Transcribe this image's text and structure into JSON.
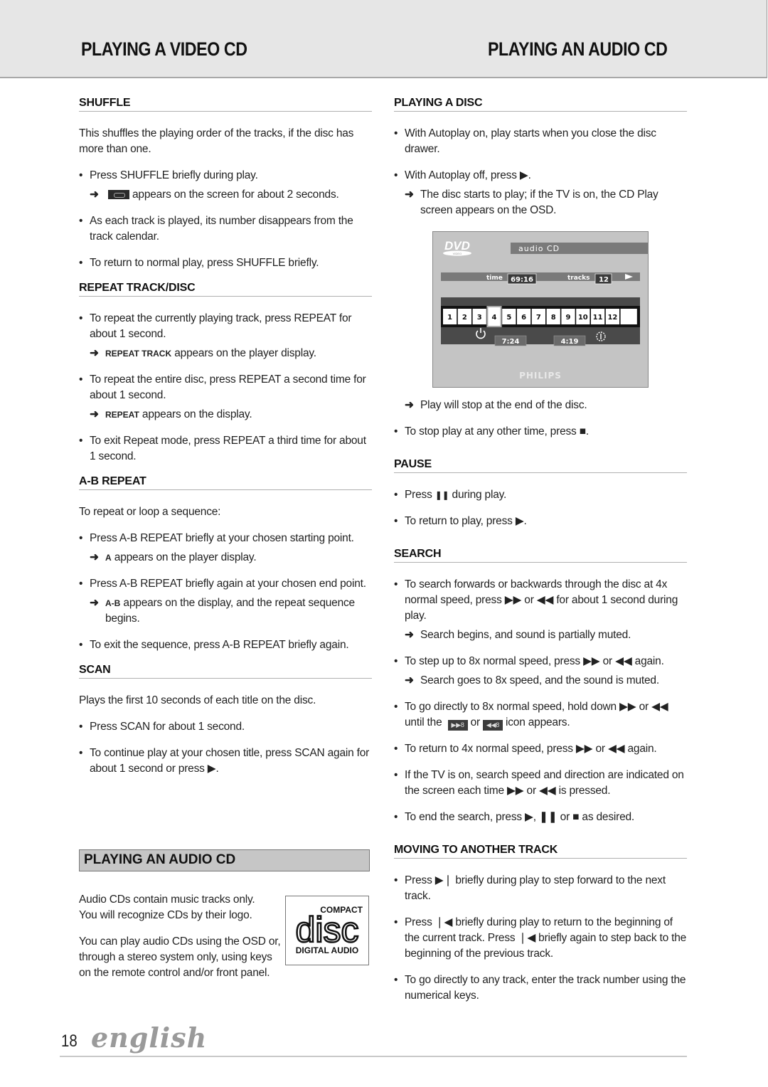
{
  "header": {
    "left_title": "PLAYING A VIDEO CD",
    "right_title": "PLAYING AN AUDIO CD"
  },
  "left": {
    "shuffle": {
      "heading": "SHUFFLE",
      "intro": "This shuffles the playing order of the tracks, if the disc has more  than one.",
      "b1": "Press SHUFFLE briefly during play.",
      "r1": "appears on the screen for about 2 seconds.",
      "b2": "As each track is played, its number disappears from the track calendar.",
      "b3": "To return to normal play, press SHUFFLE briefly."
    },
    "repeat": {
      "heading": "REPEAT TRACK/DISC",
      "b1": "To repeat the currently playing track, press REPEAT for about 1 second.",
      "r1_code": "REPEAT TRACK",
      "r1": " appears on the player display.",
      "b2": "To repeat the entire disc, press REPEAT a second time for about 1 second.",
      "r2_code": "REPEAT",
      "r2": " appears on the display.",
      "b3": "To exit Repeat mode, press REPEAT a third time for about 1 second."
    },
    "ab": {
      "heading": "A-B REPEAT",
      "intro": "To repeat or loop a sequence:",
      "b1": "Press A-B REPEAT briefly at your chosen starting point.",
      "r1_code": "A",
      "r1": " appears on the player display.",
      "b2": "Press A-B REPEAT briefly again at your chosen end point.",
      "r2_code": "A-B",
      "r2": " appears on the display, and the repeat sequence begins.",
      "b3": "To exit the sequence, press A-B REPEAT briefly again."
    },
    "scan": {
      "heading": "SCAN",
      "intro": "Plays the first 10 seconds of each title on the disc.",
      "b1": "Press SCAN for about 1 second.",
      "b2": "To continue play at your chosen title, press SCAN again for about 1 second or press ▶."
    },
    "audio_band": "PLAYING AN AUDIO CD",
    "audio_intro_1": "Audio CDs contain music tracks only. You will recognize CDs by their logo.",
    "audio_intro_2": "You can play audio CDs using the OSD or, through a stereo system only, using keys on the remote control and/or front panel.",
    "cd_logo": {
      "top": "COMPACT",
      "mid": "disc",
      "bottom": "DIGITAL AUDIO"
    }
  },
  "right": {
    "playing": {
      "heading": "PLAYING A DISC",
      "b1": "With Autoplay on, play starts when you close the disc drawer.",
      "b2": "With Autoplay off, press ▶.",
      "r1": "The disc starts to play; if the TV is on, the CD Play screen appears on the OSD.",
      "r2": "Play will stop at the end of the disc.",
      "b3": "To stop play at any other time, press ■."
    },
    "osd": {
      "logo": "DVD",
      "logo_sub": "VIDEO",
      "mode": "audio CD",
      "time_label": "time",
      "time_value": "69:16",
      "tracks_label": "tracks",
      "tracks_value": "12",
      "track_numbers": [
        "1",
        "2",
        "3",
        "4",
        "5",
        "6",
        "7",
        "8",
        "9",
        "10",
        "11",
        "12"
      ],
      "current_track": "4",
      "elapsed": "7:24",
      "remaining": "4:19",
      "brand": "PHILIPS"
    },
    "pause": {
      "heading": "PAUSE",
      "b1_pre": "Press ",
      "b1_post": " during play.",
      "b2": "To return to play, press ▶."
    },
    "search": {
      "heading": "SEARCH",
      "b1": "To search forwards or backwards through the disc at 4x normal speed, press ▶▶  or ◀◀ for about 1 second during play.",
      "r1": "Search begins, and sound is partially muted.",
      "b2": "To step up to 8x normal speed, press ▶▶  or ◀◀ again.",
      "r2": "Search goes to 8x speed, and the sound is muted.",
      "b3_pre": "To go directly to 8x normal speed, hold down ▶▶  or ◀◀ until the",
      "b3_or": "or",
      "b3_post": "icon appears.",
      "fwd_icon": "▶▶8",
      "rev_icon": "◀◀8",
      "b4": "To return to 4x normal speed, press ▶▶  or ◀◀ again.",
      "b5": "If the TV is on, search speed and direction are indicated on the screen each time ▶▶  or ◀◀ is pressed.",
      "b6": "To end the search, press ▶, ❚❚ or ■ as desired."
    },
    "moving": {
      "heading": "MOVING TO ANOTHER TRACK",
      "b1": "Press ▶❘ briefly during play to step forward to the next track.",
      "b2": "Press ❘◀ briefly during play to return to the beginning of the current track. Press ❘◀ briefly again to step back to the beginning of the previous track.",
      "b3": "To go directly to any track, enter the track number using the numerical keys."
    }
  },
  "footer": {
    "page_number": "18",
    "language": "english"
  }
}
